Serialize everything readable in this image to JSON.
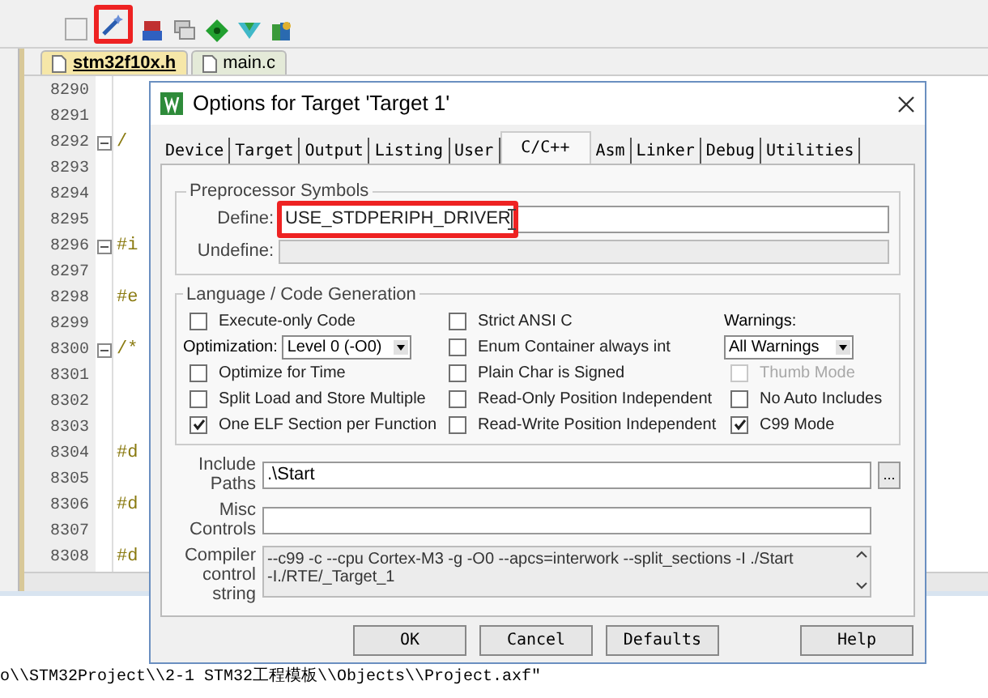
{
  "editor": {
    "tabs": [
      {
        "label": "stm32f10x.h",
        "selected": true
      },
      {
        "label": "main.c",
        "selected": false
      }
    ],
    "lines": [
      {
        "number": "8290",
        "fold": false
      },
      {
        "number": "8291",
        "fold": false
      },
      {
        "number": "8292",
        "code": "/",
        "fold": true
      },
      {
        "number": "8293",
        "fold": false
      },
      {
        "number": "8294",
        "fold": false
      },
      {
        "number": "8295",
        "fold": false
      },
      {
        "number": "8296",
        "code": "#i",
        "fold": true
      },
      {
        "number": "8297",
        "fold": false
      },
      {
        "number": "8298",
        "code": "#e",
        "fold": false
      },
      {
        "number": "8299",
        "fold": false
      },
      {
        "number": "8300",
        "code": "/*",
        "fold": true
      },
      {
        "number": "8301",
        "fold": false
      },
      {
        "number": "8302",
        "fold": false
      },
      {
        "number": "8303",
        "fold": false
      },
      {
        "number": "8304",
        "code": "#d",
        "fold": false
      },
      {
        "number": "8305",
        "fold": false
      },
      {
        "number": "8306",
        "code": "#d",
        "fold": false
      },
      {
        "number": "8307",
        "fold": false
      },
      {
        "number": "8308",
        "code": "#d",
        "fold": false
      }
    ]
  },
  "dialog": {
    "title": "Options for Target 'Target 1'",
    "tabs": [
      {
        "label": "Device",
        "selected": false
      },
      {
        "label": "Target",
        "selected": false
      },
      {
        "label": "Output",
        "selected": false
      },
      {
        "label": "Listing",
        "selected": false
      },
      {
        "label": "User",
        "selected": false
      },
      {
        "label": "C/C++",
        "selected": true
      },
      {
        "label": "Asm",
        "selected": false
      },
      {
        "label": "Linker",
        "selected": false
      },
      {
        "label": "Debug",
        "selected": false
      },
      {
        "label": "Utilities",
        "selected": false
      }
    ],
    "preprocessor": {
      "title": "Preprocessor Symbols",
      "define_label": "Define:",
      "define": "USE_STDPERIPH_DRIVER",
      "undefine_label": "Undefine:"
    },
    "language": {
      "title": "Language / Code Generation",
      "columns": [
        [
          {
            "kind": "checkbox",
            "label": "Execute-only Code",
            "checked": false,
            "disabled": false
          },
          {
            "kind": "select",
            "label": "Optimization:",
            "value": "Level 0 (-O0)"
          },
          {
            "kind": "checkbox",
            "label": "Optimize for Time",
            "checked": false,
            "disabled": false
          },
          {
            "kind": "checkbox",
            "label": "Split Load and Store Multiple",
            "checked": false,
            "disabled": false
          },
          {
            "kind": "checkbox",
            "label": "One ELF Section per Function",
            "checked": true,
            "disabled": false
          }
        ],
        [
          {
            "kind": "checkbox",
            "label": "Strict ANSI C",
            "checked": false,
            "disabled": false
          },
          {
            "kind": "checkbox",
            "label": "Enum Container always int",
            "checked": false,
            "disabled": false
          },
          {
            "kind": "checkbox",
            "label": "Plain Char is Signed",
            "checked": false,
            "disabled": false
          },
          {
            "kind": "checkbox",
            "label": "Read-Only Position Independent",
            "checked": false,
            "disabled": false
          },
          {
            "kind": "checkbox",
            "label": "Read-Write Position Independent",
            "checked": false,
            "disabled": false
          }
        ],
        [
          {
            "kind": "label",
            "label": "Warnings:"
          },
          {
            "kind": "select",
            "value": "All Warnings"
          },
          {
            "kind": "checkbox",
            "label": "Thumb Mode",
            "checked": false,
            "disabled": true
          },
          {
            "kind": "checkbox",
            "label": "No Auto Includes",
            "checked": false,
            "disabled": false
          },
          {
            "kind": "checkbox",
            "label": "C99 Mode",
            "checked": true,
            "disabled": false
          }
        ]
      ]
    },
    "include_label": [
      "Include",
      "Paths"
    ],
    "include": ".\\Start",
    "browse": "...",
    "misc_label": [
      "Misc",
      "Controls"
    ],
    "compiler_label": [
      "Compiler",
      "control",
      "string"
    ],
    "compiler": [
      "--c99 -c --cpu Cortex-M3 -g -O0 --apcs=interwork --split_sections -I ./Start",
      "-I./RTE/_Target_1"
    ],
    "buttons": [
      "OK",
      "Cancel",
      "Defaults",
      "Help"
    ]
  },
  "output": "o\\\\STM32Project\\\\2-1 STM32工程模板\\\\Objects\\\\Project.axf\""
}
